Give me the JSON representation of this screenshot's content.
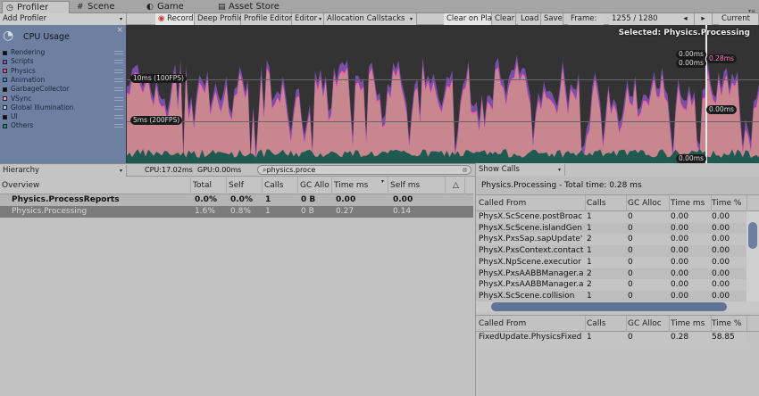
{
  "tabs": [
    {
      "label": "Profiler",
      "icon": "profiler-icon"
    },
    {
      "label": "Scene",
      "icon": "grid-icon"
    },
    {
      "label": "Game",
      "icon": "pacman-icon"
    },
    {
      "label": "Asset Store",
      "icon": "store-icon"
    }
  ],
  "toolbar": {
    "add_profiler": "Add Profiler",
    "record": "Record",
    "deep_profile": "Deep Profile",
    "profile_editor": "Profile Editor",
    "editor": "Editor",
    "allocation_callstacks": "Allocation Callstacks",
    "clear_on_play": "Clear on Play",
    "clear": "Clear",
    "load": "Load",
    "save": "Save",
    "frame_label": "Frame:",
    "frame_value": "1255 / 1280",
    "current": "Current"
  },
  "cpu_panel": {
    "title": "CPU Usage",
    "legend": [
      {
        "label": "Rendering",
        "color": "#111111"
      },
      {
        "label": "Scripts",
        "color": "#8a4fc6"
      },
      {
        "label": "Physics",
        "color": "#e0508f"
      },
      {
        "label": "Animation",
        "color": "#3a8ad4"
      },
      {
        "label": "GarbageCollector",
        "color": "#111111"
      },
      {
        "label": "VSync",
        "color": "#e79ab8"
      },
      {
        "label": "Global Illumination",
        "color": "#a8c4e0"
      },
      {
        "label": "UI",
        "color": "#111111"
      },
      {
        "label": "Others",
        "color": "#1a8a7a"
      }
    ]
  },
  "graph": {
    "selected": "Selected: Physics.Processing",
    "line_10ms": "10ms (100FPS)",
    "line_5ms": "5ms (200FPS)",
    "val_a": "0.00ms",
    "val_b": "0.00ms",
    "val_c": "0.28ms",
    "val_d": "0.00ms",
    "val_e": "0.00ms",
    "colors": {
      "area": "#c8868f",
      "physics": "#ff5aa8",
      "scripts": "#7a4fa8",
      "others": "#1e5a50"
    }
  },
  "hierarchy": {
    "view": "Hierarchy",
    "cpu": "CPU:17.02ms",
    "gpu": "GPU:0.00ms",
    "search": "physics.proce",
    "columns": [
      "Overview",
      "Total",
      "Self",
      "Calls",
      "GC Allo",
      "Time ms",
      "Self ms"
    ],
    "rows": [
      [
        "Physics.ProcessReports",
        "0.0%",
        "0.0%",
        "1",
        "0 B",
        "0.00",
        "0.00"
      ],
      [
        "Physics.Processing",
        "1.6%",
        "0.8%",
        "1",
        "0 B",
        "0.27",
        "0.14"
      ]
    ]
  },
  "details": {
    "mode": "Show Calls",
    "title": "Physics.Processing - Total time: 0.28 ms",
    "columns": [
      "Called From",
      "Calls",
      "GC Alloc",
      "Time ms",
      "Time %"
    ],
    "called_from": [
      [
        "PhysX.ScScene.postBroac",
        "1",
        "0",
        "0.00",
        "0.00"
      ],
      [
        "PhysX.ScScene.islandGen",
        "1",
        "0",
        "0.00",
        "0.00"
      ],
      [
        "PhysX.PxsSap.sapUpdate'",
        "2",
        "0",
        "0.00",
        "0.00"
      ],
      [
        "PhysX.PxsContext.contact",
        "1",
        "0",
        "0.00",
        "0.00"
      ],
      [
        "PhysX.NpScene.executior",
        "1",
        "0",
        "0.00",
        "0.00"
      ],
      [
        "PhysX.PxsAABBManager.a",
        "2",
        "0",
        "0.00",
        "0.00"
      ],
      [
        "PhysX.PxsAABBManager.a",
        "2",
        "0",
        "0.00",
        "0.00"
      ],
      [
        "PhysX.ScScene.collision",
        "1",
        "0",
        "0.00",
        "0.00"
      ]
    ],
    "calls_to": [
      [
        "FixedUpdate.PhysicsFixed",
        "1",
        "0",
        "0.28",
        "58.85"
      ]
    ]
  }
}
